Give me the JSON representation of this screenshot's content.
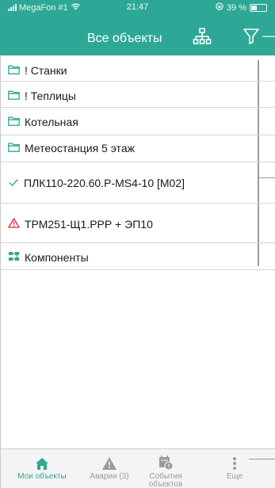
{
  "status_bar": {
    "carrier": "MegaFon #1",
    "time": "21:47",
    "battery_text": "39 %"
  },
  "header": {
    "title": "Все объекты",
    "background": "#2ea896",
    "right_icons": [
      "hierarchy-icon",
      "filter-icon"
    ]
  },
  "list": {
    "folders": [
      {
        "label": "! Станки",
        "icon": "folder-icon"
      },
      {
        "label": "! Теплицы",
        "icon": "folder-icon"
      },
      {
        "label": "Котельная",
        "icon": "folder-icon"
      },
      {
        "label": "Метеостанция 5 этаж",
        "icon": "folder-icon"
      }
    ],
    "devices": [
      {
        "label": "ПЛК110-220.60.Р-MS4-10 [M02]",
        "icon": "checkmark-icon",
        "status": "ok",
        "color": "#2ea896"
      },
      {
        "label": "ТРМ251-Щ1.РРР + ЭП10",
        "icon": "warning-icon",
        "status": "alarm",
        "color": "#e0282e"
      }
    ],
    "components": {
      "label": "Компоненты",
      "icon": "components-icon",
      "color": "#2ea896"
    }
  },
  "tab_bar": {
    "tabs": [
      {
        "label": "Мои объекты",
        "icon": "home-icon",
        "active": true
      },
      {
        "label": "Аварии (3)",
        "icon": "warning-icon",
        "active": false
      },
      {
        "label": "События объектов",
        "line1": "События",
        "line2": "объектов",
        "icon": "events-icon",
        "active": false
      },
      {
        "label": "Еще",
        "icon": "more-icon",
        "active": false
      }
    ]
  },
  "colors": {
    "accent": "#2ea896",
    "alarm": "#e0282e",
    "inactive": "#9a9a9a"
  }
}
